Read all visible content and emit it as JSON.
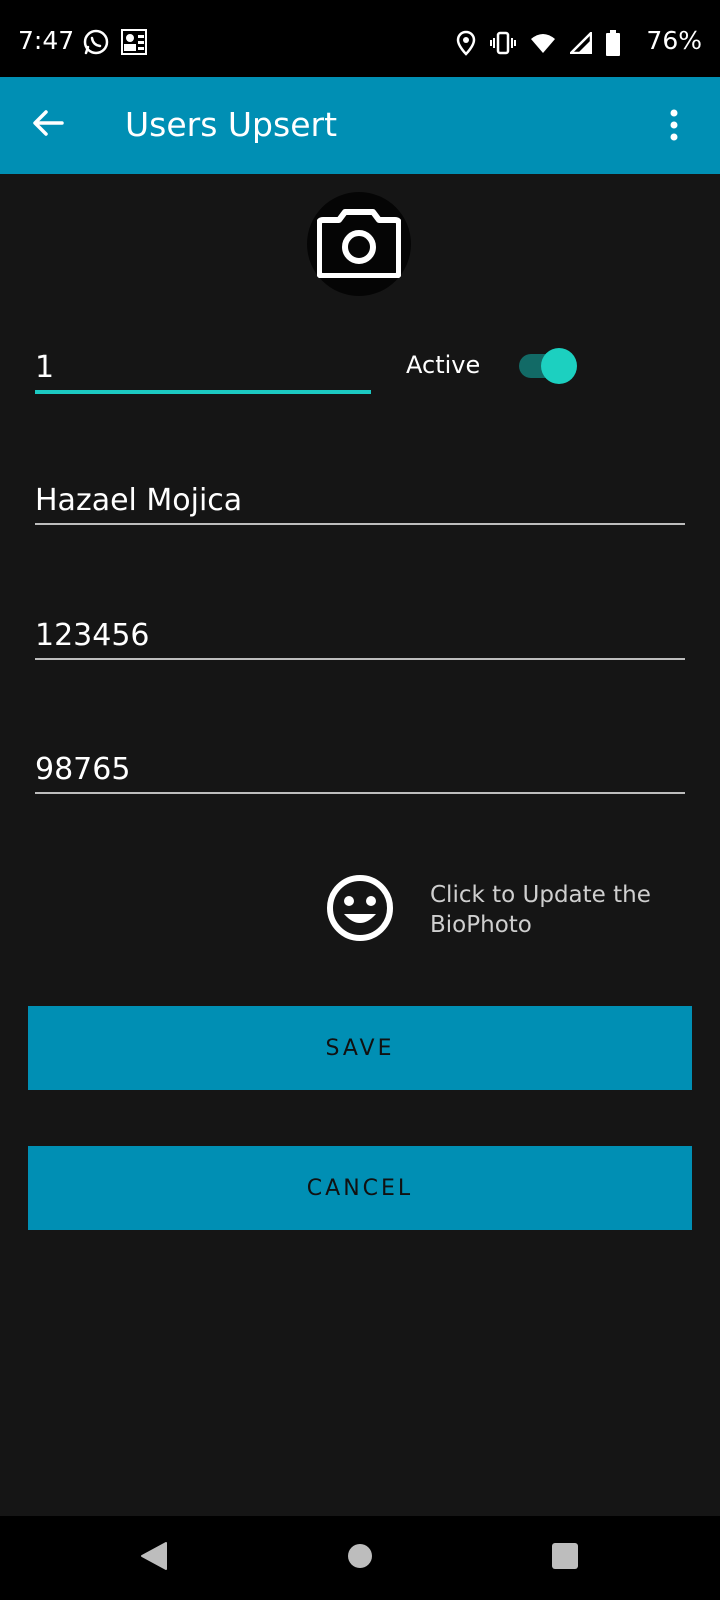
{
  "status_bar": {
    "time": "7:47",
    "battery": "76%",
    "icons_left": [
      "whatsapp-icon",
      "contact-card-icon"
    ],
    "icons_right": [
      "location-icon",
      "vibrate-icon",
      "wifi-icon",
      "signal-icon",
      "battery-icon"
    ]
  },
  "app_bar": {
    "title": "Users Upsert",
    "color": "#008fb4"
  },
  "form": {
    "id_value": "1",
    "active_label": "Active",
    "active_on": true,
    "name_value": "Hazael Mojica",
    "field2_value": "123456",
    "field3_value": "98765",
    "bio_text": "Click to Update the BioPhoto"
  },
  "buttons": {
    "save_label": "SAVE",
    "cancel_label": "CANCEL"
  },
  "colors": {
    "accent": "#1cc9c2",
    "background": "#151515"
  }
}
